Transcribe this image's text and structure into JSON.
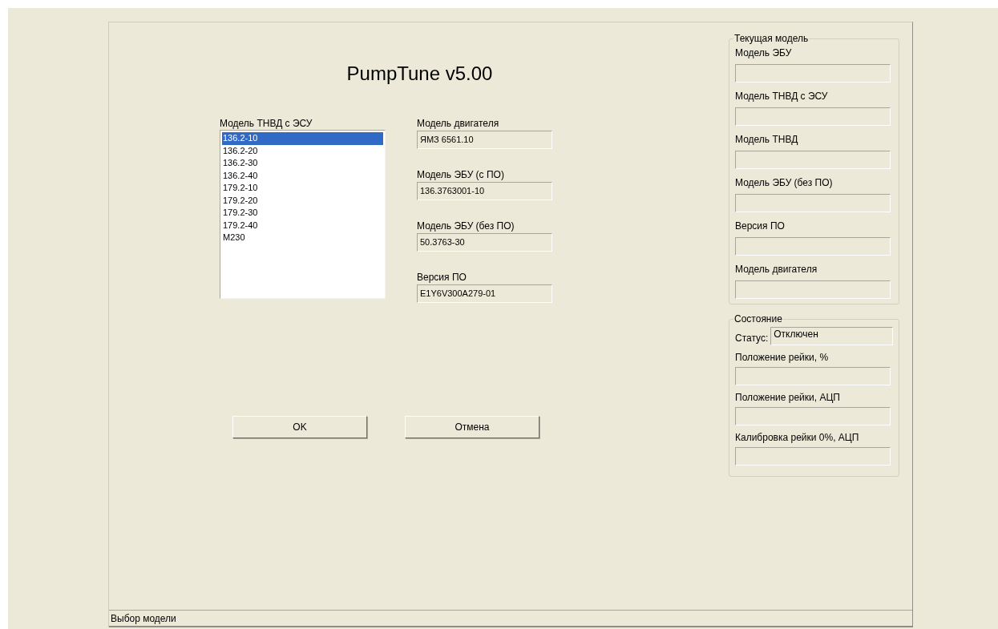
{
  "title": "PumpTune v5.00",
  "model_list": {
    "label": "Модель ТНВД с ЭСУ",
    "items": [
      {
        "text": "136.2-10",
        "selected": true
      },
      {
        "text": "136.2-20",
        "selected": false
      },
      {
        "text": "136.2-30",
        "selected": false
      },
      {
        "text": "136.2-40",
        "selected": false
      },
      {
        "text": "179.2-10",
        "selected": false
      },
      {
        "text": "179.2-20",
        "selected": false
      },
      {
        "text": "179.2-30",
        "selected": false
      },
      {
        "text": "179.2-40",
        "selected": false
      },
      {
        "text": "M230",
        "selected": false
      }
    ]
  },
  "fields": [
    {
      "label": "Модель двигателя",
      "value": "ЯМЗ 6561.10"
    },
    {
      "label": "Модель ЭБУ (с ПО)",
      "value": "136.3763001-10"
    },
    {
      "label": "Модель ЭБУ (без ПО)",
      "value": "50.3763-30"
    },
    {
      "label": "Версия ПО",
      "value": "E1Y6V300A279-01"
    }
  ],
  "buttons": [
    "OK",
    "Отмена"
  ],
  "current_model": {
    "title": "Текущая модель",
    "fields": [
      {
        "label": "Модель ЭБУ"
      },
      {
        "label": "Модель ТНВД с ЭСУ"
      },
      {
        "label": "Модель ТНВД"
      },
      {
        "label": "Модель ЭБУ (без ПО)"
      },
      {
        "label": "Версия ПО"
      },
      {
        "label": "Модель двигателя"
      }
    ]
  },
  "state": {
    "title": "Состояние",
    "status_label": "Статус:",
    "status_value": "Отключен",
    "fields": [
      {
        "label": "Положение рейки, %"
      },
      {
        "label": "Положение рейки, АЦП"
      },
      {
        "label": "Калибровка рейки 0%, АЦП"
      }
    ]
  },
  "status_bar": "Выбор модели"
}
